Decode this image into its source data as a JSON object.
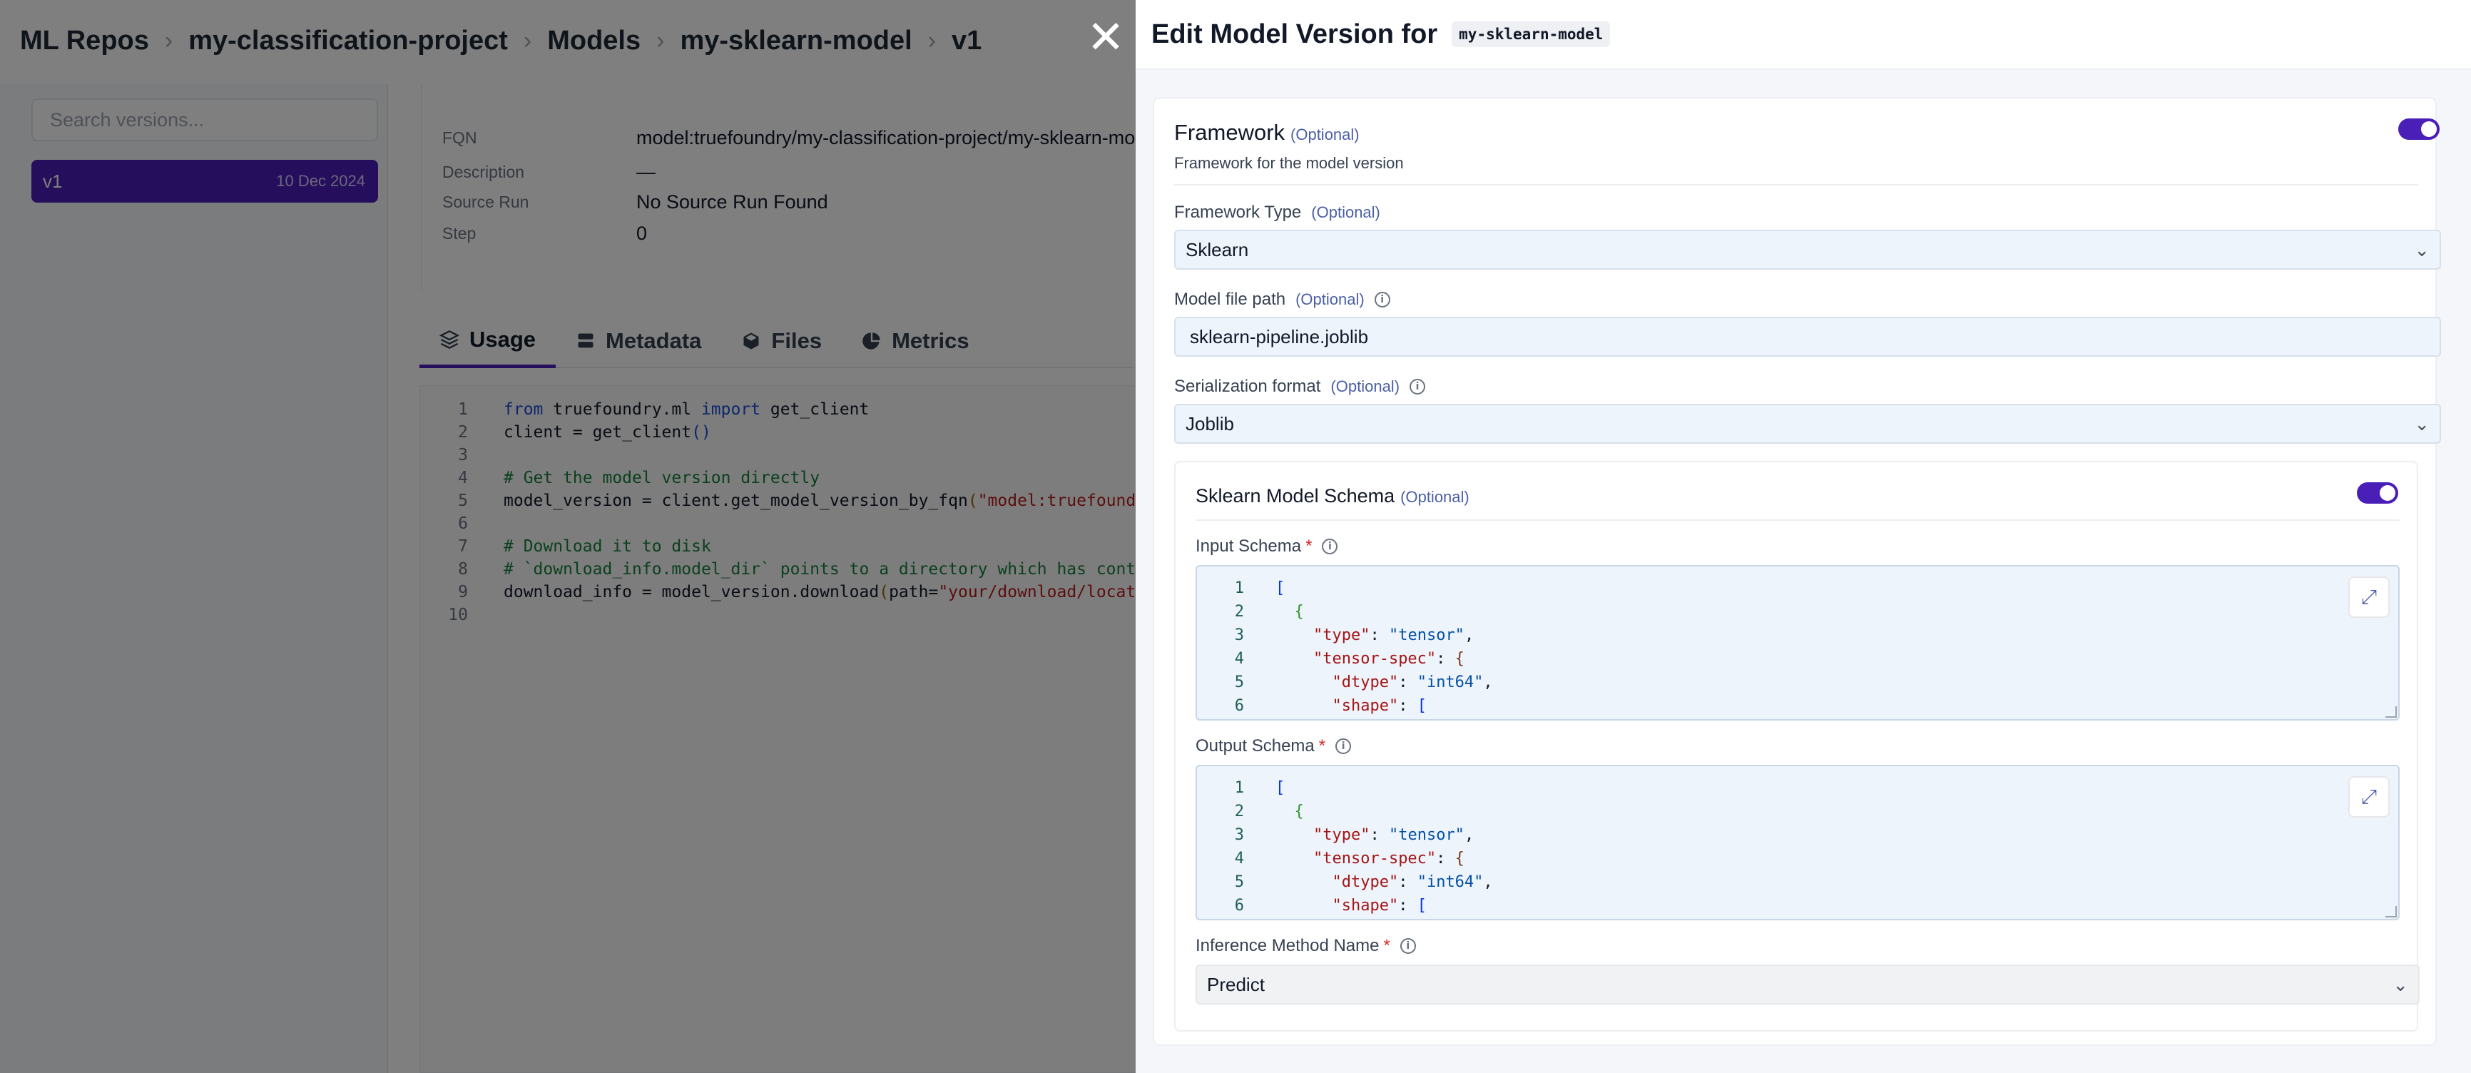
{
  "breadcrumb": [
    "ML Repos",
    "my-classification-project",
    "Models",
    "my-sklearn-model",
    "v1"
  ],
  "search": {
    "placeholder": "Search versions..."
  },
  "versions": [
    {
      "name": "v1",
      "date": "10 Dec 2024"
    }
  ],
  "details": [
    {
      "label": "FQN",
      "value": "model:truefoundry/my-classification-project/my-sklearn-mod"
    },
    {
      "label": "Description",
      "value": "—"
    },
    {
      "label": "Source Run",
      "value": "No Source Run Found"
    },
    {
      "label": "Step",
      "value": "0"
    }
  ],
  "tabs": [
    {
      "label": "Usage",
      "icon": "layers-icon",
      "active": true
    },
    {
      "label": "Metadata",
      "icon": "database-icon",
      "active": false
    },
    {
      "label": "Files",
      "icon": "box-icon",
      "active": false
    },
    {
      "label": "Metrics",
      "icon": "pie-chart-icon",
      "active": false
    }
  ],
  "code": {
    "line_numbers": [
      "1",
      "2",
      "3",
      "4",
      "5",
      "6",
      "7",
      "8",
      "9",
      "10"
    ],
    "l1_kw1": "from",
    "l1_mid": " truefoundry.ml ",
    "l1_kw2": "import",
    "l1_end": " get_client",
    "l2_a": "client = get_client",
    "l2_b": "()",
    "l4": "# Get the model version directly",
    "l5_a": "model_version = client.get_model_version_by_fqn",
    "l5_b": "(",
    "l5_c": "\"model:truefoundry/my",
    "l7": "# Download it to disk",
    "l8": "# `download_info.model_dir` points to a directory which has contents",
    "l9_a": "download_info = model_version.download",
    "l9_b": "(",
    "l9_c": "path=",
    "l9_d": "\"your/download/location\"",
    "l9_e": ")"
  },
  "drawer": {
    "title": "Edit Model Version for",
    "model_name": "my-sklearn-model",
    "close_icon": "close-icon",
    "framework": {
      "title": "Framework",
      "optional": "(Optional)",
      "description": "Framework for the model version",
      "enabled": true
    },
    "framework_type": {
      "label": "Framework Type",
      "optional": "(Optional)",
      "value": "Sklearn"
    },
    "model_file_path": {
      "label": "Model file path",
      "optional": "(Optional)",
      "value": "sklearn-pipeline.joblib"
    },
    "serialization_format": {
      "label": "Serialization format",
      "optional": "(Optional)",
      "value": "Joblib"
    },
    "schema": {
      "title": "Sklearn Model Schema",
      "optional": "(Optional)",
      "enabled": true,
      "input_label": "Input Schema",
      "output_label": "Output Schema",
      "required_mark": "*",
      "lines": [
        "1",
        "2",
        "3",
        "4",
        "5",
        "6"
      ],
      "j_open": "[",
      "j_obj": "{",
      "j_type_key": "\"type\"",
      "j_type_val": "\"tensor\"",
      "j_spec_key": "\"tensor-spec\"",
      "j_dtype_key": "\"dtype\"",
      "j_dtype_val": "\"int64\"",
      "j_shape_key": "\"shape\"",
      "j_bracket": "["
    },
    "inference_method": {
      "label": "Inference Method Name",
      "required_mark": "*",
      "value": "Predict"
    }
  },
  "colors": {
    "accent": "#4a1fb8",
    "overlay": "rgba(0,0,0,0.5)"
  }
}
